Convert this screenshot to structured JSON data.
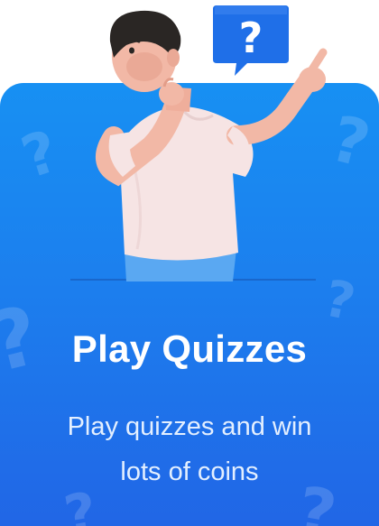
{
  "card": {
    "title": "Play Quizzes",
    "description_lines": [
      "Play quizzes and win",
      "lots of coins"
    ]
  },
  "speech_bubble": {
    "symbol": "?",
    "color": "#1f6fe8"
  },
  "icons": [
    "question-mark-icon",
    "speech-bubble-icon"
  ],
  "colors": {
    "card_gradient_top": "#1790f3",
    "card_gradient_bottom": "#2166e6",
    "title": "#ffffff",
    "description": "#e3efff"
  }
}
